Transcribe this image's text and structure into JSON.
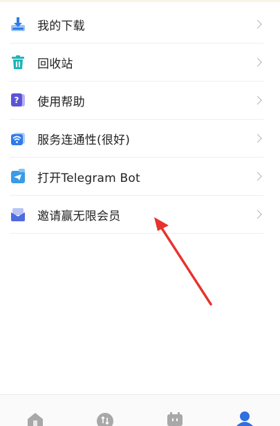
{
  "menu": {
    "items": [
      {
        "label": "我的下载",
        "icon": "download-icon"
      },
      {
        "label": "回收站",
        "icon": "trash-icon"
      },
      {
        "label": "使用帮助",
        "icon": "help-icon"
      },
      {
        "label": "服务连通性(很好)",
        "icon": "wifi-icon"
      },
      {
        "label": "打开Telegram Bot",
        "icon": "telegram-icon"
      },
      {
        "label": "邀请赢无限会员",
        "icon": "invite-mail-icon"
      }
    ]
  },
  "tabbar": {
    "tabs": [
      {
        "icon": "home-icon",
        "active": false
      },
      {
        "icon": "transfer-icon",
        "active": false
      },
      {
        "icon": "robot-icon",
        "active": false
      },
      {
        "icon": "profile-icon",
        "active": true
      }
    ]
  },
  "colors": {
    "accent": "#2f6fe0",
    "annotation_arrow": "#e8322d",
    "divider": "#eeeeee",
    "chevron": "#b4b4b4"
  }
}
